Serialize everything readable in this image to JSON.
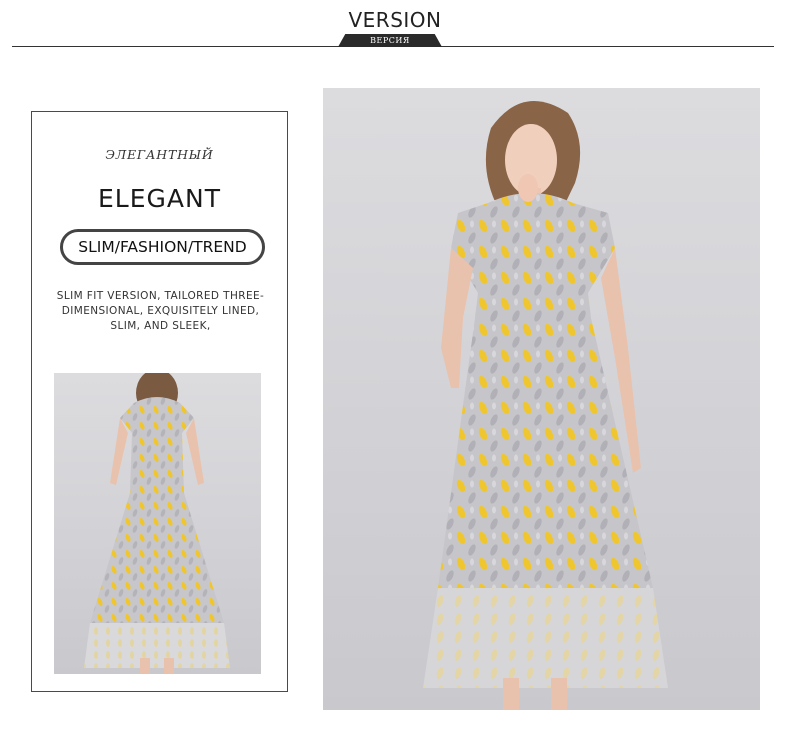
{
  "header": {
    "title": "VERSION",
    "tab_label": "ВЕРСИЯ"
  },
  "left_panel": {
    "subtitle_ru": "ЭЛЕГАНТНЫЙ",
    "title": "ELEGANT",
    "pill_text": "SLIM/FASHION/TREND",
    "description_lines": [
      "SLIM FIT VERSION, TAILORED THREE-",
      "DIMENSIONAL, EXQUISITELY LINED,",
      "SLIM, AND SLEEK,"
    ]
  },
  "colors": {
    "background": "#ffffff",
    "text": "#1a1a1a",
    "dress_base": "#c8c8cc",
    "dress_leaf_yellow": "#f0c62e",
    "photo_backdrop": "#d6d6da"
  }
}
